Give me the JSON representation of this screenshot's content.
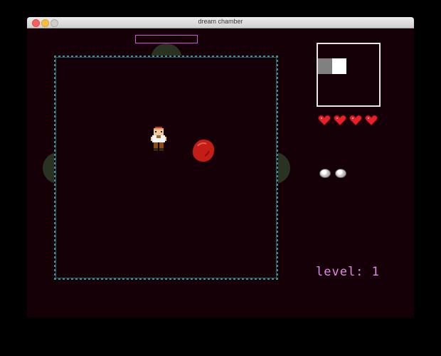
{
  "window": {
    "title": "dream chamber"
  },
  "hud": {
    "hearts": {
      "count": 4,
      "color": "#e8202a",
      "icon": "heart-icon"
    },
    "orbs": {
      "count": 2,
      "icon": "orb-icon"
    },
    "level_text": "level: 1"
  },
  "minimap": {
    "rooms": [
      {
        "state": "explored",
        "color": "#808080"
      },
      {
        "state": "current",
        "color": "#ffffff"
      }
    ]
  },
  "room": {
    "doors": [
      "top",
      "left",
      "right"
    ],
    "border_color": "#3d8f93",
    "door_color": "#2a3321"
  },
  "entities": {
    "player": {
      "icon": "player-sprite"
    },
    "enemy": {
      "icon": "red-blob-enemy",
      "color": "#c41d16"
    }
  },
  "colors": {
    "background": "#160008",
    "accent_pink": "#e08ae8",
    "bar_outline": "#d44cd9"
  }
}
